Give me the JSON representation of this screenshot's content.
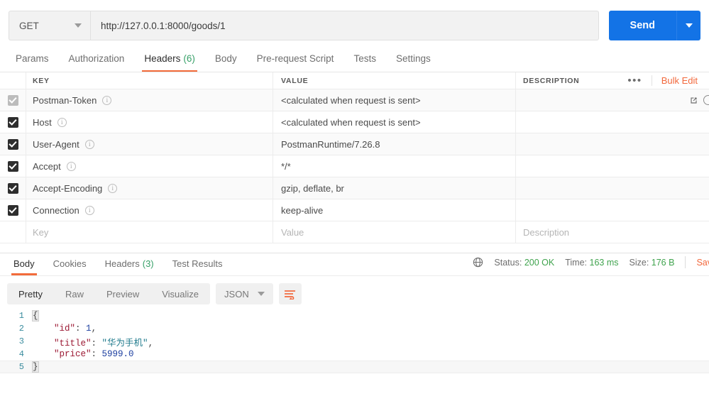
{
  "request": {
    "method": "GET",
    "url": "http://127.0.0.1:8000/goods/1",
    "send_label": "Send",
    "tabs": [
      {
        "label": "Params",
        "count": "",
        "active": false
      },
      {
        "label": "Authorization",
        "count": "",
        "active": false
      },
      {
        "label": "Headers",
        "count": "(6)",
        "active": true
      },
      {
        "label": "Body",
        "count": "",
        "active": false
      },
      {
        "label": "Pre-request Script",
        "count": "",
        "active": false
      },
      {
        "label": "Tests",
        "count": "",
        "active": false
      },
      {
        "label": "Settings",
        "count": "",
        "active": false
      }
    ]
  },
  "headers_table": {
    "columns": {
      "key": "KEY",
      "value": "VALUE",
      "description": "DESCRIPTION"
    },
    "dots_label": "•••",
    "bulk_edit_label": "Bulk Edit",
    "rows": [
      {
        "checked": true,
        "disabled": true,
        "key": "Postman-Token",
        "value": "<calculated when request is sent>",
        "description": ""
      },
      {
        "checked": true,
        "disabled": false,
        "key": "Host",
        "value": "<calculated when request is sent>",
        "description": ""
      },
      {
        "checked": true,
        "disabled": false,
        "key": "User-Agent",
        "value": "PostmanRuntime/7.26.8",
        "description": ""
      },
      {
        "checked": true,
        "disabled": false,
        "key": "Accept",
        "value": "*/*",
        "description": ""
      },
      {
        "checked": true,
        "disabled": false,
        "key": "Accept-Encoding",
        "value": "gzip, deflate, br",
        "description": ""
      },
      {
        "checked": true,
        "disabled": false,
        "key": "Connection",
        "value": "keep-alive",
        "description": ""
      }
    ],
    "empty_row": {
      "key": "Key",
      "value": "Value",
      "description": "Description"
    }
  },
  "response": {
    "tabs": [
      {
        "label": "Body",
        "count": "",
        "active": true
      },
      {
        "label": "Cookies",
        "count": "",
        "active": false
      },
      {
        "label": "Headers",
        "count": "(3)",
        "active": false
      },
      {
        "label": "Test Results",
        "count": "",
        "active": false
      }
    ],
    "status_label": "Status:",
    "status_value": "200 OK",
    "time_label": "Time:",
    "time_value": "163 ms",
    "size_label": "Size:",
    "size_value": "176 B",
    "save_response_label": "Sav",
    "view_modes": [
      {
        "label": "Pretty",
        "active": true
      },
      {
        "label": "Raw",
        "active": false
      },
      {
        "label": "Preview",
        "active": false
      },
      {
        "label": "Visualize",
        "active": false
      }
    ],
    "format": "JSON",
    "body_lines": [
      {
        "num": "1",
        "segments": [
          {
            "t": "{",
            "c": "brace"
          }
        ]
      },
      {
        "num": "2",
        "segments": [
          {
            "t": "    ",
            "c": "p"
          },
          {
            "t": "\"id\"",
            "c": "k"
          },
          {
            "t": ": ",
            "c": "p"
          },
          {
            "t": "1",
            "c": "n"
          },
          {
            "t": ",",
            "c": "p"
          }
        ]
      },
      {
        "num": "3",
        "segments": [
          {
            "t": "    ",
            "c": "p"
          },
          {
            "t": "\"title\"",
            "c": "k"
          },
          {
            "t": ": ",
            "c": "p"
          },
          {
            "t": "\"华为手机\"",
            "c": "s"
          },
          {
            "t": ",",
            "c": "p"
          }
        ]
      },
      {
        "num": "4",
        "segments": [
          {
            "t": "    ",
            "c": "p"
          },
          {
            "t": "\"price\"",
            "c": "k"
          },
          {
            "t": ": ",
            "c": "p"
          },
          {
            "t": "5999.0",
            "c": "n"
          }
        ]
      },
      {
        "num": "5",
        "segments": [
          {
            "t": "}",
            "c": "brace"
          }
        ]
      }
    ]
  },
  "colors": {
    "accent_orange": "#f26b3a",
    "send_blue": "#1373e6",
    "status_green": "#3fa34d",
    "count_green": "#38a169"
  }
}
